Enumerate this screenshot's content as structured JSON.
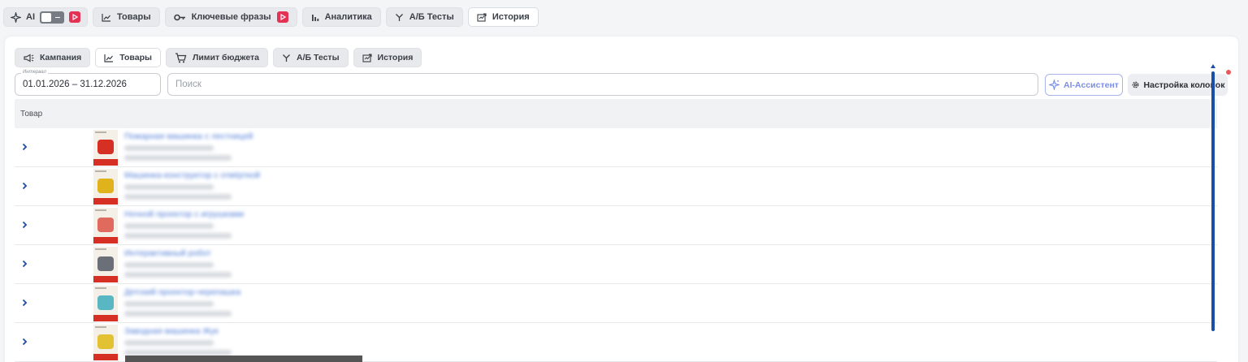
{
  "top_tabs": {
    "ai_label": "AI",
    "items": [
      {
        "label": "Товары",
        "icon": "line-chart-icon"
      },
      {
        "label": "Ключевые фразы",
        "icon": "key-icon"
      },
      {
        "label": "Аналитика",
        "icon": "bar-chart-icon"
      },
      {
        "label": "А/Б Тесты",
        "icon": "split-icon"
      },
      {
        "label": "История",
        "icon": "history-icon"
      }
    ],
    "active": "История"
  },
  "sub_tabs": {
    "items": [
      {
        "label": "Кампания",
        "icon": "megaphone-icon"
      },
      {
        "label": "Товары",
        "icon": "line-chart-icon"
      },
      {
        "label": "Лимит бюджета",
        "icon": "cart-icon"
      },
      {
        "label": "А/Б Тесты",
        "icon": "split-icon"
      },
      {
        "label": "История",
        "icon": "history-icon"
      }
    ],
    "active": "Товары"
  },
  "filters": {
    "interval_label": "Интервал",
    "interval_value": "01.01.2026 – 31.12.2026",
    "search_placeholder": "Поиск",
    "ai_assistant_label": "AI-Ассистент",
    "columns_settings_label": "Настройка колонок"
  },
  "table": {
    "header": "Товар",
    "rows": [
      {
        "title": "Пожарная машинка с лестницей",
        "thumb_color": "#d62f24"
      },
      {
        "title": "Машинка-конструктор с отвёрткой",
        "thumb_color": "#e0b21c"
      },
      {
        "title": "Ночной проектор с игрушками",
        "thumb_color": "#e06a5e"
      },
      {
        "title": "Интерактивный робот",
        "thumb_color": "#6a6f78"
      },
      {
        "title": "Детский проектор-черепашка",
        "thumb_color": "#58b7c2"
      },
      {
        "title": "Заводная машинка Жук",
        "thumb_color": "#e2c232"
      }
    ]
  },
  "colors": {
    "accent": "#1a4ea8",
    "ai_accent": "#7d8de6",
    "link": "#4d7bd6",
    "badge_red": "#e53153"
  }
}
